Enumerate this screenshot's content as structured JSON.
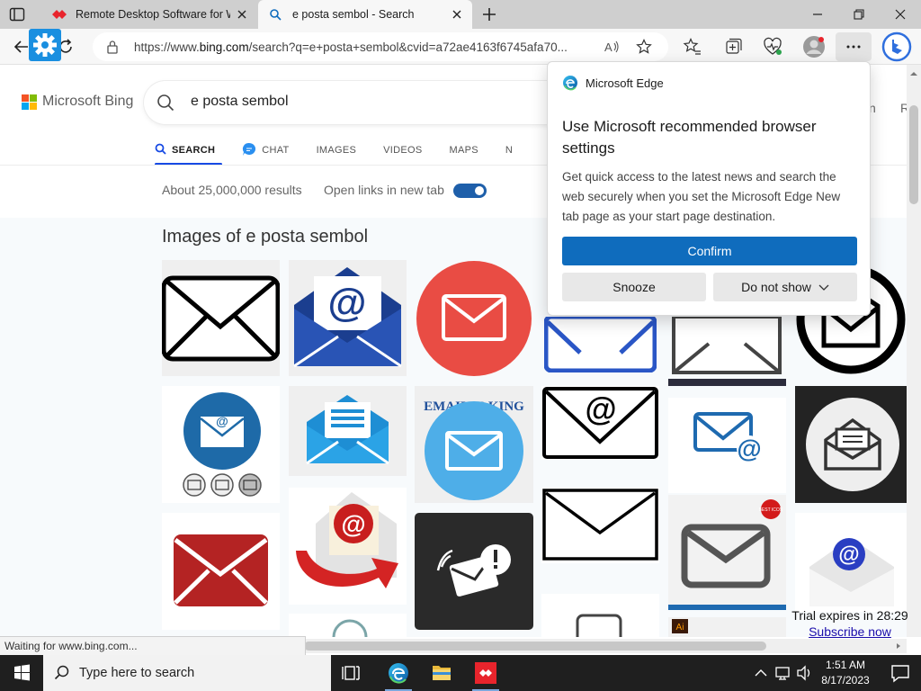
{
  "browser": {
    "tabs": [
      {
        "label": "Remote Desktop Software for W",
        "active": false,
        "icon": "rdp-red-diamond-icon"
      },
      {
        "label": "e posta sembol - Search",
        "active": true,
        "icon": "search-icon"
      }
    ],
    "url_prefix": "https://www.",
    "url_domain": "bing.com",
    "url_rest": "/search?q=e+posta+sembol&cvid=a72ae4163f6745afa70..."
  },
  "bing": {
    "brand": "Microsoft Bing",
    "query": "e posta sembol",
    "right_partial_1": "n",
    "right_partial_2": "R",
    "scopes": [
      {
        "label": "SEARCH",
        "active": true
      },
      {
        "label": "CHAT",
        "active": false
      },
      {
        "label": "IMAGES",
        "active": false
      },
      {
        "label": "VIDEOS",
        "active": false
      },
      {
        "label": "MAPS",
        "active": false
      },
      {
        "label": "N",
        "active": false
      }
    ],
    "results_count": "About 25,000,000 results",
    "open_links_label": "Open links in new tab",
    "open_links_on": true,
    "images_heading": "Images of e posta sembol",
    "email_is_king": "EMAIL IS KING",
    "best_badge": "BEST ICON"
  },
  "popup": {
    "app_name": "Microsoft Edge",
    "title": "Use Microsoft recommended browser settings",
    "body": "Get quick access to the latest news and search the web securely when you set the Microsoft Edge New tab page as your start page destination.",
    "confirm": "Confirm",
    "snooze": "Snooze",
    "do_not_show": "Do not show"
  },
  "status_text": "Waiting for www.bing.com...",
  "trial": {
    "text": "Trial expires in 28:29",
    "link": "Subscribe now"
  },
  "taskbar": {
    "search_placeholder": "Type here to search",
    "time": "1:51 AM",
    "date": "8/17/2023"
  },
  "colors": {
    "accent_blue": "#0f6cbd",
    "bing_underline": "#174ae4",
    "toggle": "#1e5faa",
    "rdp_red": "#e8242c"
  }
}
